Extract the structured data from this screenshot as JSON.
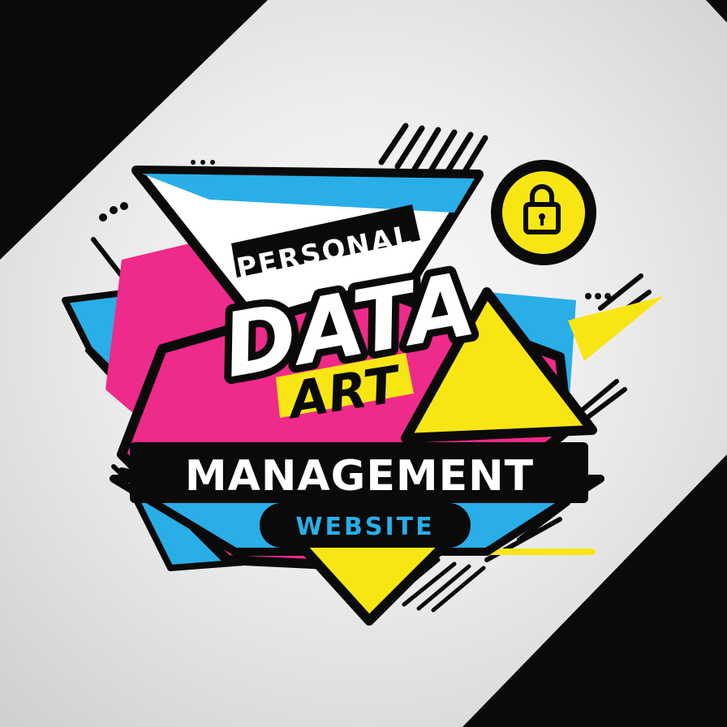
{
  "logo": {
    "line1": "PERSONAL",
    "line2": "DATA",
    "line3": "ART",
    "line4": "MANAGEMENT",
    "line5": "WEBSITE"
  },
  "icon": "padlock-icon",
  "colors": {
    "cyan": "#29aee8",
    "magenta": "#ee2a8a",
    "yellow": "#f8e614",
    "black": "#0a0a0a",
    "white": "#ffffff",
    "background": "#ececec"
  }
}
